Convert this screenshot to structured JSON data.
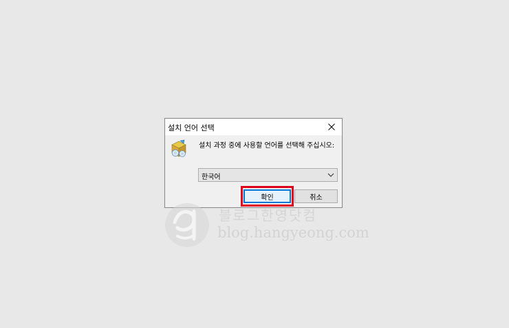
{
  "dialog": {
    "title": "설치 언어 선택",
    "prompt": "설치 과정 중에 사용할 언어를 선택해 주십시오:",
    "language_select": {
      "value": "한국어"
    },
    "buttons": {
      "ok_label": "확인",
      "cancel_label": "취소"
    },
    "icons": {
      "close": "close-icon",
      "setup": "setup-package-icon",
      "dropdown": "chevron-down-icon"
    },
    "highlight_color": "#e0001b"
  },
  "watermark": {
    "korean_text": "블로그한영닷컴",
    "url_text": "blog.hangyeong.com"
  }
}
